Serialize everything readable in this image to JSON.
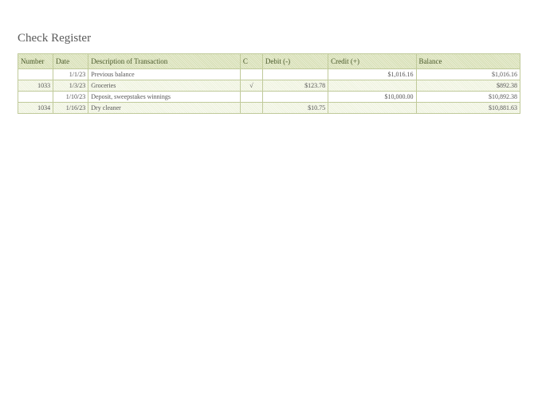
{
  "title": "Check Register",
  "headers": {
    "number": "Number",
    "date": "Date",
    "description": "Description of Transaction",
    "c": "C",
    "debit": "Debit  (-)",
    "credit": "Credit (+)",
    "balance": "Balance"
  },
  "rows": [
    {
      "number": "",
      "date": "1/1/23",
      "description": "Previous balance",
      "c": "",
      "debit": "",
      "credit": "$1,016.16",
      "balance": "$1,016.16"
    },
    {
      "number": "1033",
      "date": "1/3/23",
      "description": "Groceries",
      "c": "√",
      "debit": "$123.78",
      "credit": "",
      "balance": "$892.38"
    },
    {
      "number": "",
      "date": "1/10/23",
      "description": "Deposit, sweepstakes winnings",
      "c": "",
      "debit": "",
      "credit": "$10,000.00",
      "balance": "$10,892.38"
    },
    {
      "number": "1034",
      "date": "1/16/23",
      "description": "Dry cleaner",
      "c": "",
      "debit": "$10.75",
      "credit": "",
      "balance": "$10,881.63"
    }
  ]
}
